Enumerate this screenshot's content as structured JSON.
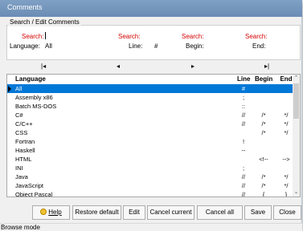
{
  "window": {
    "title": "Comments"
  },
  "search": {
    "group_label": "Search / Edit Comments",
    "language_search_label": "Search:",
    "language_label": "Language:",
    "language_value": "All",
    "line_search_label": "Search:",
    "line_label": "Line:",
    "line_value": "#",
    "begin_search_label": "Search:",
    "begin_label": "Begin:",
    "begin_value": "",
    "end_search_label": "Search:",
    "end_label": "End:",
    "end_value": ""
  },
  "navigator": {
    "first": "|◂",
    "prior": "◂",
    "next": "▸",
    "last": "▸|"
  },
  "grid": {
    "columns": {
      "language": "Language",
      "line": "Line",
      "begin": "Begin",
      "end": "End"
    },
    "rows": [
      {
        "language": "All",
        "line": "#",
        "begin": "",
        "end": ""
      },
      {
        "language": "Assembly x86",
        "line": ";",
        "begin": "",
        "end": ""
      },
      {
        "language": "Batch MS-DOS",
        "line": "::",
        "begin": "",
        "end": ""
      },
      {
        "language": "C#",
        "line": "//",
        "begin": "/*",
        "end": "*/"
      },
      {
        "language": "C/C++",
        "line": "//",
        "begin": "/*",
        "end": "*/"
      },
      {
        "language": "CSS",
        "line": "",
        "begin": "/*",
        "end": "*/"
      },
      {
        "language": "Fortran",
        "line": "!",
        "begin": "",
        "end": ""
      },
      {
        "language": "Haskell",
        "line": "--",
        "begin": "",
        "end": ""
      },
      {
        "language": "HTML",
        "line": "",
        "begin": "<!--",
        "end": "-->"
      },
      {
        "language": "INI",
        "line": ";",
        "begin": "",
        "end": ""
      },
      {
        "language": "Java",
        "line": "//",
        "begin": "/*",
        "end": "*/"
      },
      {
        "language": "JavaScript",
        "line": "//",
        "begin": "/*",
        "end": "*/"
      },
      {
        "language": "Object Pascal",
        "line": "//",
        "begin": "{",
        "end": "}"
      }
    ],
    "selected_index": 0
  },
  "scrollbar": {
    "up": "⌃",
    "down": "⌄"
  },
  "buttons": {
    "help": "Help",
    "restore_default": "Restore default",
    "edit": "Edit",
    "cancel_current": "Cancel current",
    "cancel_all": "Cancel all",
    "save": "Save",
    "close": "Close"
  },
  "status": {
    "text": "Browse mode"
  }
}
